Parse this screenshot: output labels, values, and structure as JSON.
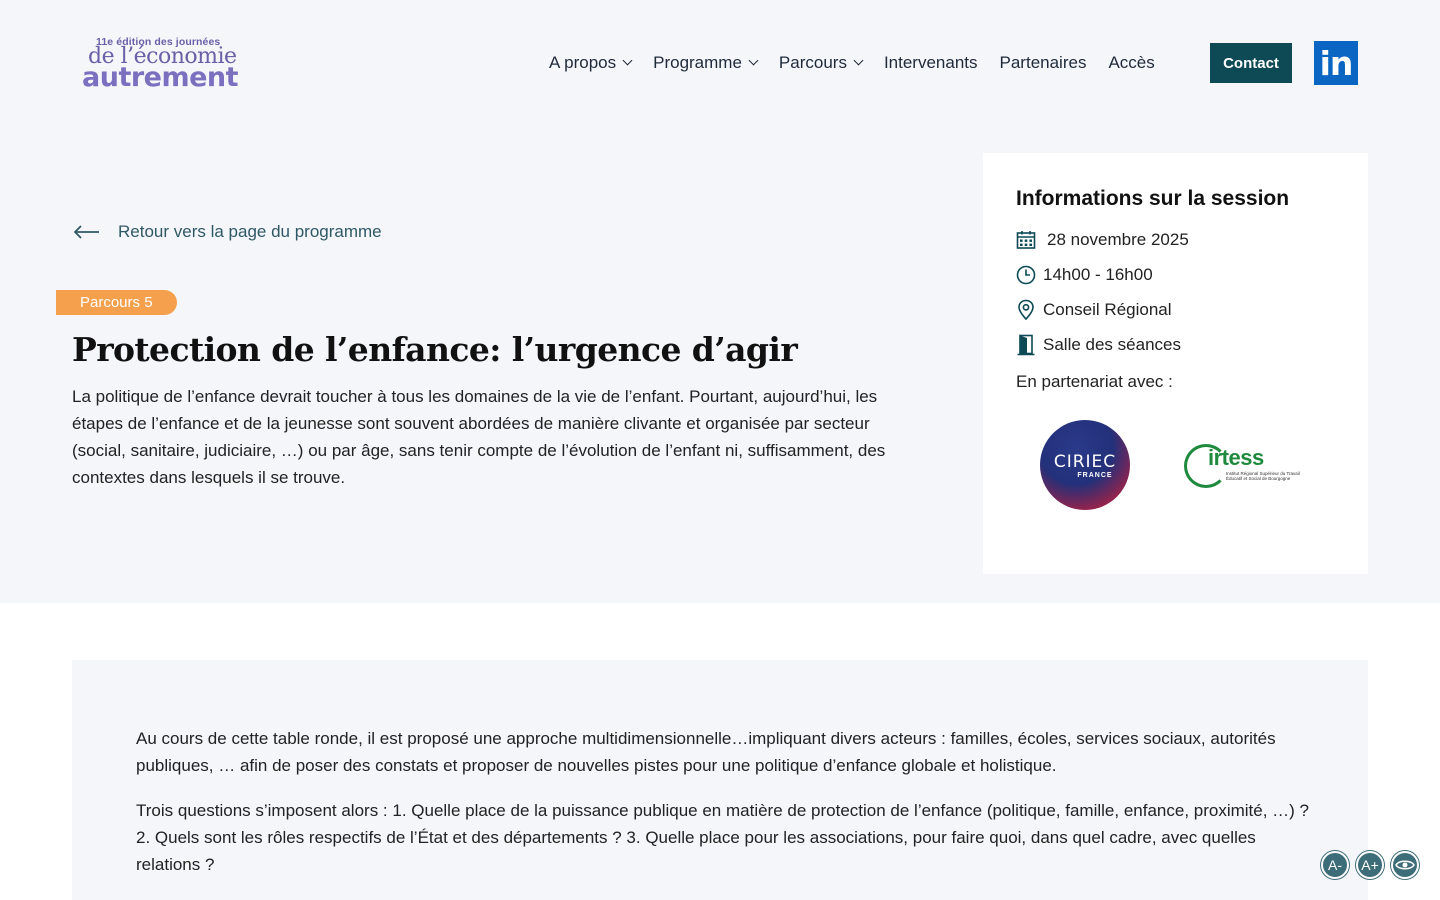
{
  "header": {
    "logo": {
      "line1": "11e édition des journées",
      "line2": "de l’économie",
      "line3": "autrement"
    },
    "nav": [
      {
        "label": "A propos",
        "has_dropdown": true
      },
      {
        "label": "Programme",
        "has_dropdown": true
      },
      {
        "label": "Parcours",
        "has_dropdown": true
      },
      {
        "label": "Intervenants",
        "has_dropdown": false
      },
      {
        "label": "Partenaires",
        "has_dropdown": false
      },
      {
        "label": "Accès",
        "has_dropdown": false
      }
    ],
    "contact_label": "Contact",
    "linkedin_label": "in"
  },
  "back_link": "Retour vers la page du programme",
  "badge": "Parcours 5",
  "title": "Protection de l’enfance: l’urgence d’agir",
  "intro": "La politique de l’enfance devrait toucher à tous les domaines de la vie de l’enfant. Pourtant, aujourd’hui, les étapes de l’enfance et de la jeunesse sont souvent abordées de manière clivante et organisée par secteur (social, sanitaire, judiciaire, …) ou par âge, sans tenir compte de l’évolution de l’enfant ni, suffisamment, des contextes dans lesquels il se trouve.",
  "session": {
    "heading": "Informations sur la session",
    "date": "28 novembre 2025",
    "time": "14h00 - 16h00",
    "place": "Conseil Régional",
    "room": "Salle des séances",
    "partner_label": "En partenariat avec :",
    "partners": {
      "ciriec": {
        "name": "CIRIEC",
        "sub": "FRANCE"
      },
      "irtess": {
        "name": "irtess",
        "sub": "Institut Régional Supérieur du Travail Éducatif et Social de Bourgogne"
      }
    }
  },
  "content": {
    "p1": "Au cours de cette table ronde, il est proposé une approche multidimensionnelle…impliquant divers acteurs : familles, écoles, services sociaux, autorités publiques, … afin de poser des constats et proposer de nouvelles pistes pour une politique d’enfance globale et holistique.",
    "p2": "Trois questions s’imposent alors : 1. Quelle place de la puissance publique en matière de protection de l’enfance (politique, famille, enfance, proximité, …) ? 2. Quels sont les rôles respectifs de l’État et des départements ? 3. Quelle place pour les associations, pour faire quoi, dans quel cadre, avec quelles relations ?"
  },
  "accessibility": {
    "decrease": "A-",
    "increase": "A+"
  },
  "colors": {
    "accent": "#0d4a55",
    "badge": "#f4a04c",
    "logo": "#6b5fa8",
    "linkedin": "#0a66c2"
  }
}
